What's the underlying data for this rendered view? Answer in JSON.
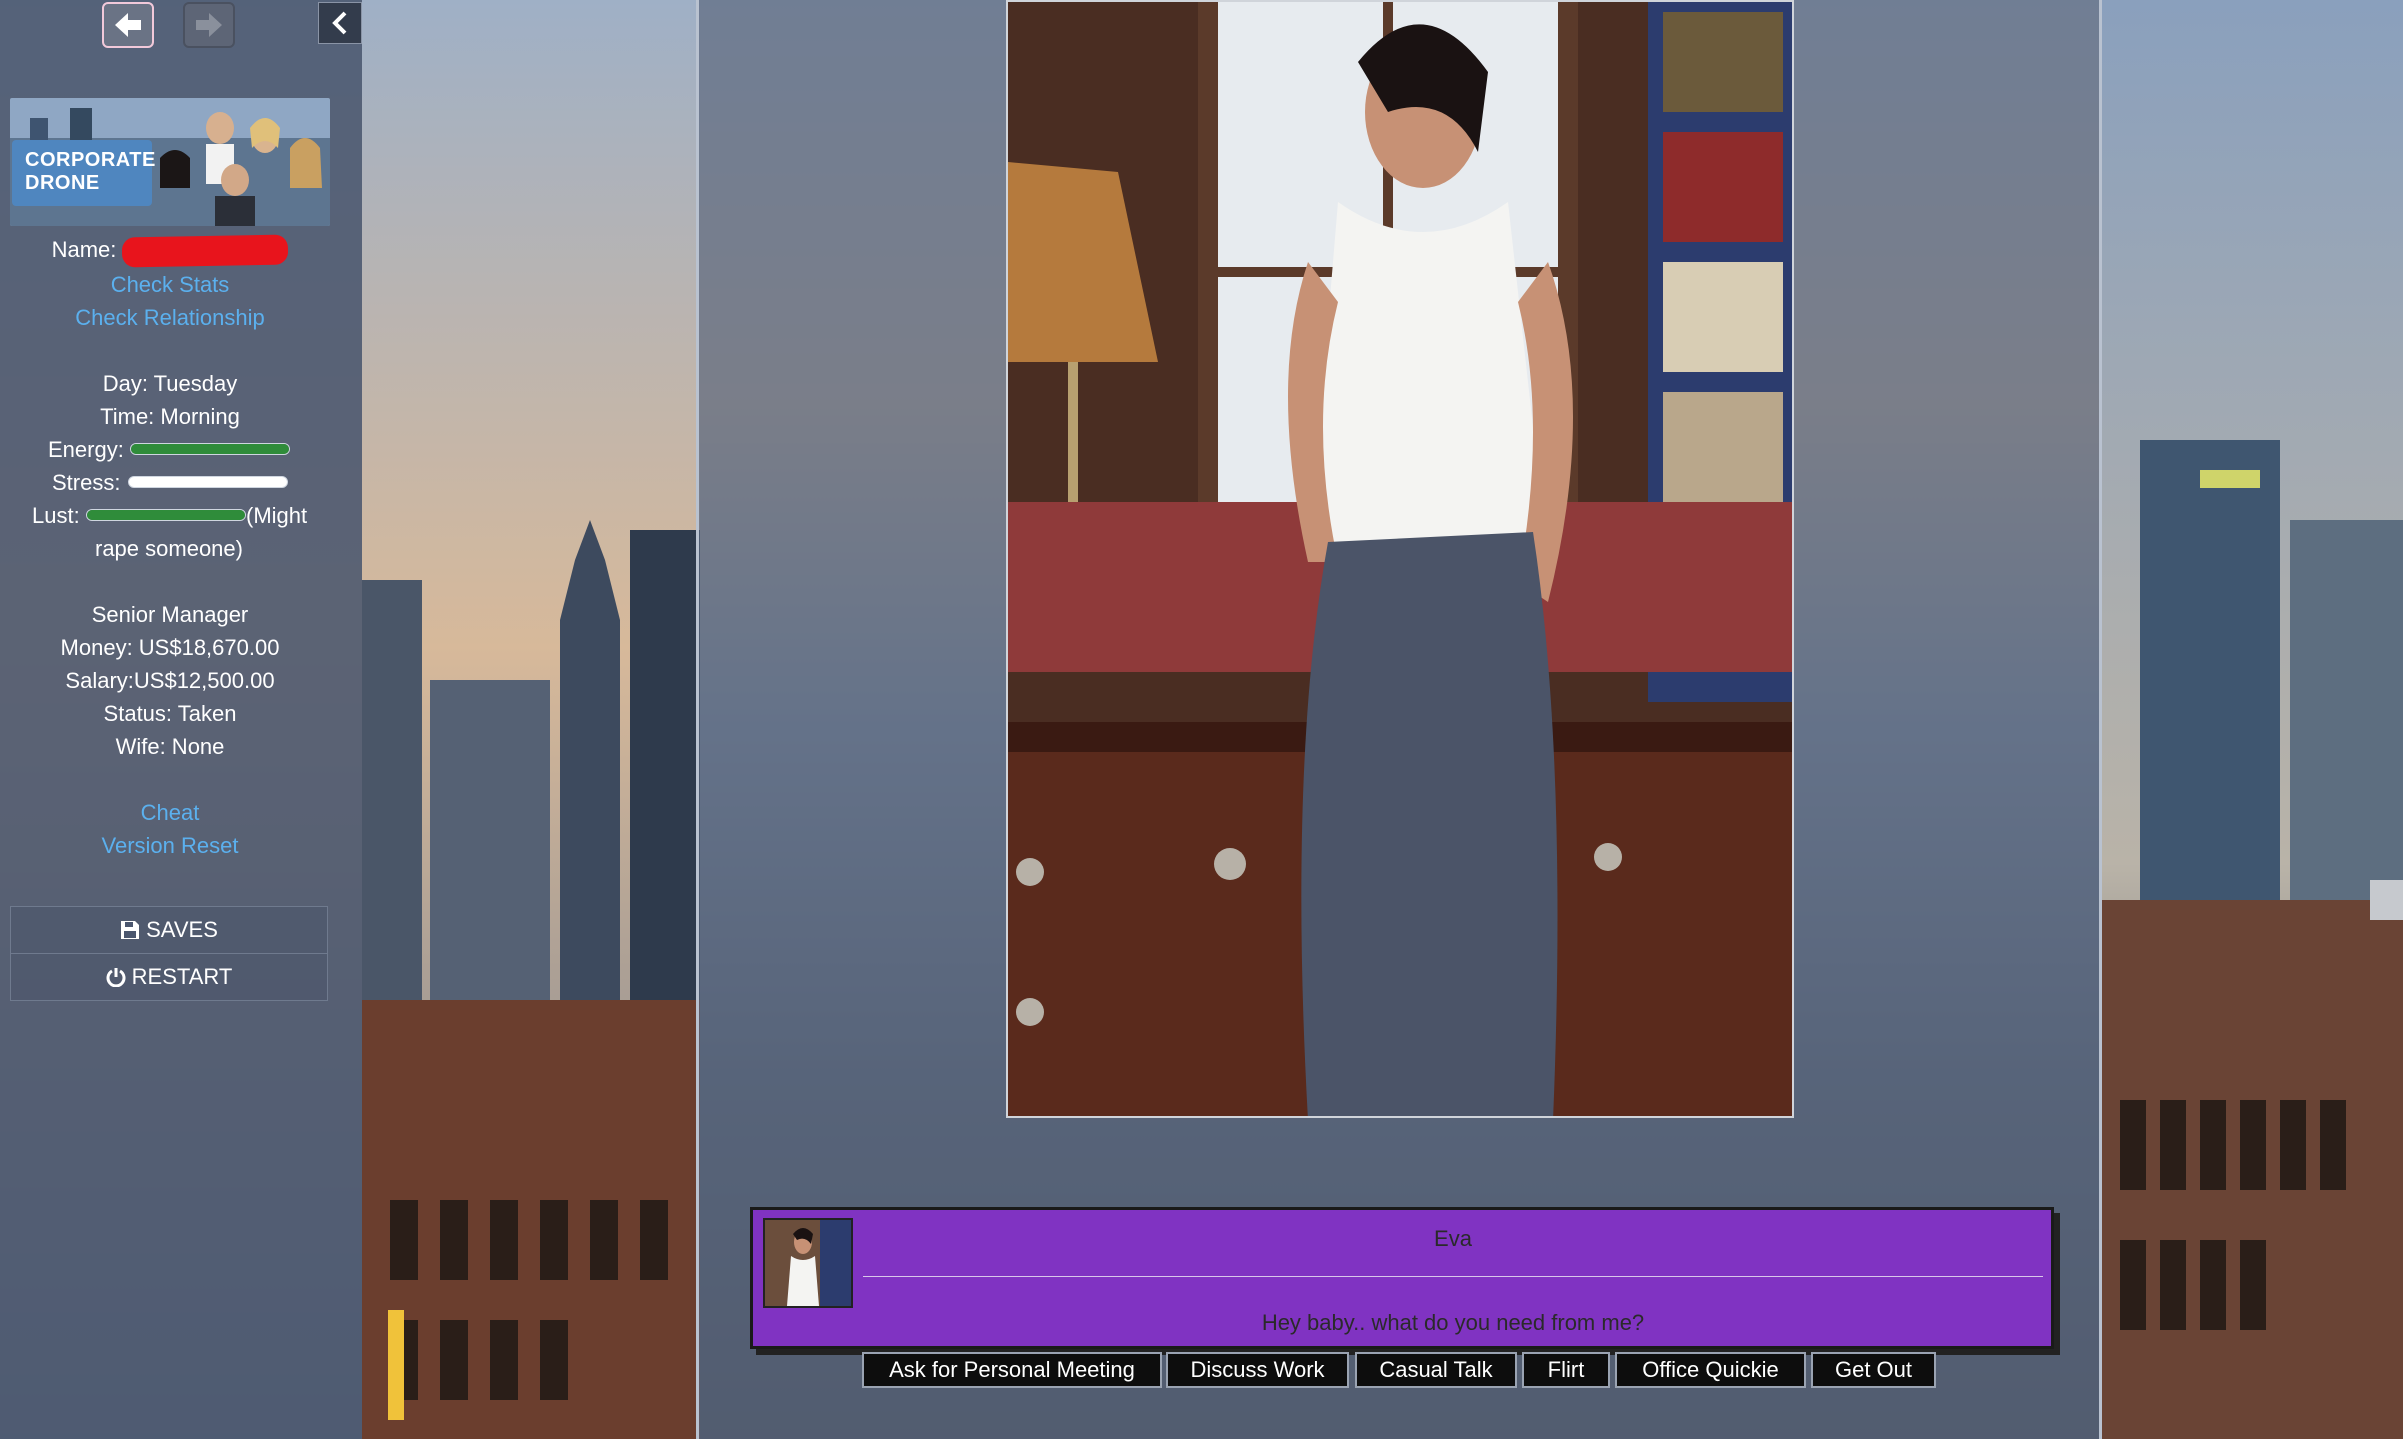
{
  "sidebar": {
    "nav": {
      "back_icon": "arrow-left-icon",
      "forward_icon": "arrow-right-icon",
      "toggle_icon": "chevron-left-icon"
    },
    "banner": {
      "logo_line1": "CORPORATE",
      "logo_line2": "DRONE"
    },
    "name_label": "Name:",
    "links": {
      "check_stats": "Check Stats",
      "check_relationship": "Check Relationship",
      "cheat": "Cheat",
      "version_reset": "Version Reset"
    },
    "status": {
      "day": "Day: Tuesday",
      "time": "Time: Morning",
      "energy_label": "Energy:",
      "energy_level": 1.0,
      "stress_label": "Stress:",
      "stress_level": 0.0,
      "lust_label": "Lust:",
      "lust_level": 1.0,
      "lust_note_1": "(Might",
      "lust_note_2": "rape someone)",
      "job_title": "Senior Manager",
      "money": "Money: US$18,670.00",
      "salary": "Salary:US$12,500.00",
      "relationship_status": "Status: Taken",
      "wife": "Wife: None"
    },
    "menu": {
      "saves_label": "SAVES",
      "saves_icon": "floppy-disk-icon",
      "restart_label": "RESTART",
      "restart_icon": "power-icon"
    }
  },
  "dialog": {
    "speaker": "Eva",
    "text": "Hey baby.. what do you need from me?",
    "box_color": "#8033c2"
  },
  "choices": [
    {
      "label": "Ask for Personal Meeting"
    },
    {
      "label": "Discuss Work"
    },
    {
      "label": "Casual Talk"
    },
    {
      "label": "Flirt"
    },
    {
      "label": "Office Quickie"
    },
    {
      "label": "Get Out"
    }
  ],
  "colors": {
    "link": "#5bb0ee",
    "meter_fill": "#2f8c3a",
    "redaction": "#e8141c"
  }
}
